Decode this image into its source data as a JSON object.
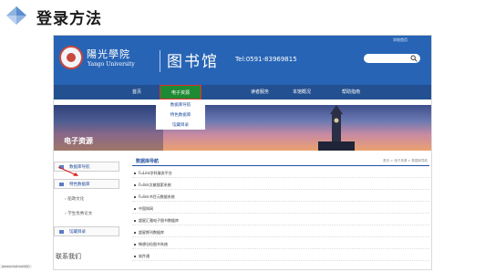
{
  "slide": {
    "title": "登录方法"
  },
  "site": {
    "top_link": "学校首页",
    "logo_cn": "陽光學院",
    "logo_en": "Yango University",
    "library_name": "图书馆",
    "tel": "Tel:0591-83969815",
    "nav": [
      {
        "label": "首页"
      },
      {
        "label": "电子资源"
      },
      {
        "label": "读者服务"
      },
      {
        "label": "本馆概况"
      },
      {
        "label": "帮助指南"
      }
    ],
    "dropdown": [
      {
        "label": "数据库导航"
      },
      {
        "label": "特色数据库"
      },
      {
        "label": "馆藏目录"
      }
    ],
    "banner_title": "电子资源",
    "sidebar": {
      "items": [
        {
          "label": "数据库导航"
        },
        {
          "label": "特色数据库"
        }
      ],
      "subitems": [
        {
          "label": "船政文化"
        },
        {
          "label": "学生优秀论文"
        }
      ],
      "catalog": "馆藏目录",
      "contact": "联系我们"
    },
    "content": {
      "title": "数据库导航",
      "breadcrumb": "首页 > 电子资源 > 数据库导航",
      "databases": [
        "FuLink学科服务平台",
        "Fulink文献搜索系统",
        "Fulink书目元数据系统",
        "中国知网",
        "超星汇雅电子图书数据库",
        "超星期刊数据库",
        "畅想谷粒图书系统",
        "软件通"
      ]
    },
    "status_text": "javascript:void(0)"
  },
  "colors": {
    "header_blue": "#2764b5",
    "nav_blue": "#235090",
    "active_green": "#1f8a34",
    "highlight_red": "#e03030"
  }
}
